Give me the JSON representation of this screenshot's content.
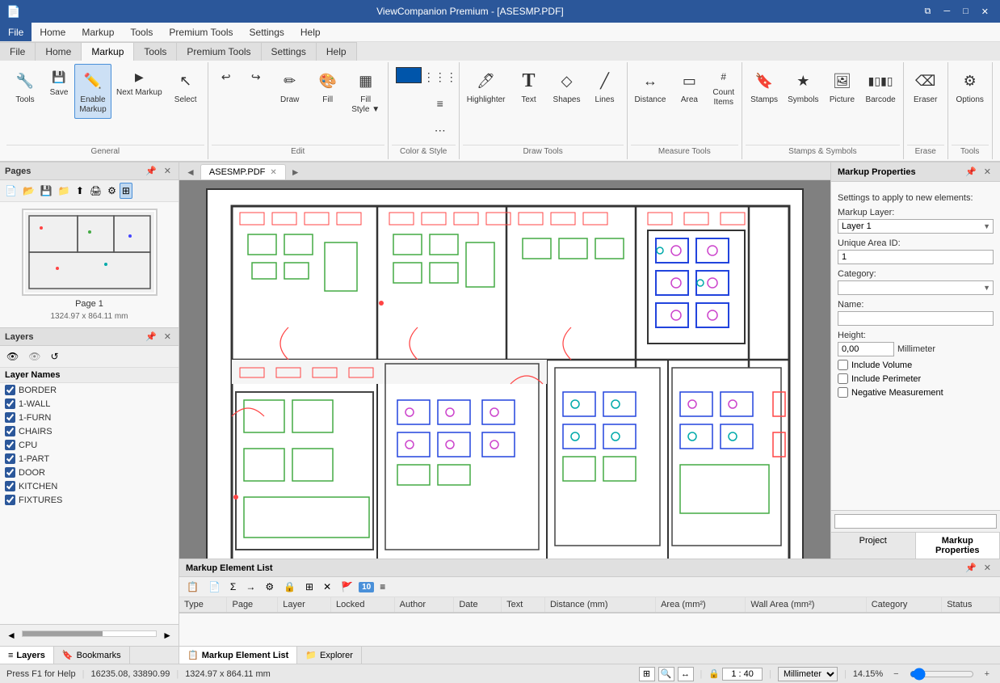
{
  "app": {
    "title": "ViewCompanion Premium - [ASESMP.PDF]",
    "window_controls": [
      "minimize",
      "maximize",
      "close"
    ]
  },
  "menu": {
    "items": [
      "File",
      "Home",
      "Markup",
      "Tools",
      "Premium Tools",
      "Settings",
      "Help"
    ]
  },
  "ribbon": {
    "active_tab": "Markup",
    "groups": [
      {
        "label": "General",
        "buttons": [
          {
            "id": "tools",
            "label": "Tools",
            "icon": "🔧"
          },
          {
            "id": "save",
            "label": "Save",
            "icon": "💾"
          },
          {
            "id": "enable-markup",
            "label": "Enable Markup",
            "icon": "✏️",
            "active": true
          },
          {
            "id": "next-markup",
            "label": "Next Markup",
            "icon": "▶"
          },
          {
            "id": "select",
            "label": "Select",
            "icon": "↖"
          }
        ]
      },
      {
        "label": "Edit",
        "buttons": [
          {
            "id": "undo",
            "label": "Undo",
            "icon": "↩"
          },
          {
            "id": "redo",
            "label": "Redo",
            "icon": "↪"
          },
          {
            "id": "draw",
            "label": "Draw",
            "icon": "✏"
          },
          {
            "id": "fill",
            "label": "Fill",
            "icon": "🎨"
          },
          {
            "id": "fill-style",
            "label": "Fill Style",
            "icon": "▦"
          }
        ]
      },
      {
        "label": "Color & Style",
        "buttons": [
          {
            "id": "color-btn",
            "label": "",
            "icon": "■",
            "color": "#0055aa"
          },
          {
            "id": "lines",
            "label": "Lines",
            "icon": "—"
          },
          {
            "id": "more1",
            "label": "",
            "icon": "⋯"
          }
        ]
      },
      {
        "label": "Draw Tools",
        "buttons": [
          {
            "id": "highlighter",
            "label": "Highlighter",
            "icon": "🖊"
          },
          {
            "id": "text",
            "label": "Text",
            "icon": "T"
          },
          {
            "id": "shapes",
            "label": "Shapes",
            "icon": "◇"
          },
          {
            "id": "lines-draw",
            "label": "Lines",
            "icon": "╱"
          }
        ]
      },
      {
        "label": "Measure Tools",
        "buttons": [
          {
            "id": "distance",
            "label": "Distance",
            "icon": "↔"
          },
          {
            "id": "area",
            "label": "Area",
            "icon": "▭"
          },
          {
            "id": "count-items",
            "label": "Count Items",
            "icon": "#"
          }
        ]
      },
      {
        "label": "Stamps & Symbols",
        "buttons": [
          {
            "id": "stamps",
            "label": "Stamps",
            "icon": "🔖"
          },
          {
            "id": "symbols",
            "label": "Symbols",
            "icon": "★"
          },
          {
            "id": "picture",
            "label": "Picture",
            "icon": "🖼"
          },
          {
            "id": "barcode",
            "label": "Barcode",
            "icon": "▮"
          }
        ]
      },
      {
        "label": "Erase",
        "buttons": [
          {
            "id": "eraser",
            "label": "Eraser",
            "icon": "⌫"
          }
        ]
      },
      {
        "label": "Tools",
        "buttons": [
          {
            "id": "options",
            "label": "Options",
            "icon": "⚙"
          }
        ]
      }
    ]
  },
  "pages_panel": {
    "title": "Pages",
    "toolbar_buttons": [
      "new",
      "open",
      "save",
      "open-file",
      "save-file",
      "print",
      "settings",
      "thumbnail"
    ],
    "page": {
      "label": "Page 1",
      "dimensions": "1324.97 x 864.11 mm"
    }
  },
  "layers_panel": {
    "title": "Layers",
    "toolbar_icons": [
      "eye-on",
      "eye-off",
      "refresh"
    ],
    "header": "Layer Names",
    "layers": [
      {
        "name": "BORDER",
        "checked": true
      },
      {
        "name": "1-WALL",
        "checked": true
      },
      {
        "name": "1-FURN",
        "checked": true
      },
      {
        "name": "CHAIRS",
        "checked": true
      },
      {
        "name": "CPU",
        "checked": true
      },
      {
        "name": "1-PART",
        "checked": true
      },
      {
        "name": "DOOR",
        "checked": true
      },
      {
        "name": "KITCHEN",
        "checked": true
      },
      {
        "name": "FIXTURES",
        "checked": true
      }
    ]
  },
  "panel_tabs": [
    {
      "id": "layers",
      "label": "Layers",
      "icon": "≡",
      "active": true
    },
    {
      "id": "bookmarks",
      "label": "Bookmarks",
      "icon": "🔖"
    }
  ],
  "document": {
    "tab_name": "ASESMP.PDF",
    "filename": "ASESMP.PDF"
  },
  "markup_properties": {
    "title": "Markup Properties",
    "settings_label": "Settings to apply to new elements:",
    "markup_layer_label": "Markup Layer:",
    "markup_layer_value": "Layer 1",
    "unique_area_id_label": "Unique Area ID:",
    "unique_area_id_value": "1",
    "category_label": "Category:",
    "category_value": "",
    "name_label": "Name:",
    "name_value": "",
    "height_label": "Height:",
    "height_value": "0,00",
    "height_unit": "Millimeter",
    "include_volume": "Include Volume",
    "include_perimeter": "Include Perimeter",
    "negative_measurement": "Negative Measurement"
  },
  "right_panel_tabs": [
    {
      "id": "project",
      "label": "Project"
    },
    {
      "id": "markup-properties",
      "label": "Markup Properties",
      "active": true
    }
  ],
  "markup_list": {
    "title": "Markup Element List",
    "badge_count": "10",
    "toolbar_icons": [
      "add",
      "copy",
      "sum",
      "export",
      "filter",
      "lock",
      "group",
      "delete",
      "flag",
      "number",
      "layers"
    ],
    "columns": [
      "Type",
      "Page",
      "Layer",
      "Locked",
      "Author",
      "Date",
      "Text",
      "Distance (mm)",
      "Area (mm²)",
      "Wall Area (mm²)",
      "Category",
      "Status"
    ],
    "rows": []
  },
  "bottom_tabs": [
    {
      "id": "markup-element-list",
      "label": "Markup Element List",
      "icon": "📋",
      "active": true
    },
    {
      "id": "explorer",
      "label": "Explorer",
      "icon": "📁"
    }
  ],
  "status_bar": {
    "help": "Press F1 for Help",
    "coordinates": "16235.08, 33890.99",
    "dimensions": "1324.97 x 864.11 mm",
    "scale": "1 : 40",
    "unit": "Millimeter",
    "zoom": "14.15%"
  }
}
